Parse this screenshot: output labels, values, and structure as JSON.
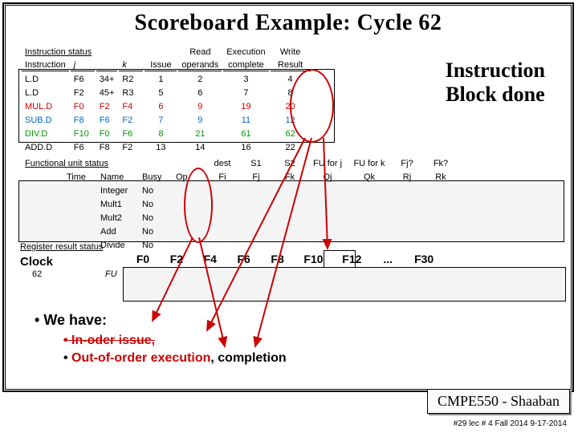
{
  "title": "Scoreboard Example:  Cycle 62",
  "headers": {
    "instr_status": "Instruction status",
    "instruction": "Instruction",
    "j": "j",
    "k": "k",
    "issue": "Issue",
    "read": "Read",
    "operands": "operands",
    "execution": "Execution",
    "complete": "complete",
    "write": "Write",
    "result": "Result"
  },
  "instr": [
    {
      "op": "L.D",
      "j": "F6",
      "k": "34+",
      "r": "R2",
      "issue": "1",
      "read": "2",
      "exec": "3",
      "write": "4"
    },
    {
      "op": "L.D",
      "j": "F2",
      "k": "45+",
      "r": "R3",
      "issue": "5",
      "read": "6",
      "exec": "7",
      "write": "8"
    },
    {
      "op": "MUL.D",
      "j": "F0",
      "k": "F2",
      "r": "F4",
      "issue": "6",
      "read": "9",
      "exec": "19",
      "write": "20"
    },
    {
      "op": "SUB.D",
      "j": "F8",
      "k": "F6",
      "r": "F2",
      "issue": "7",
      "read": "9",
      "exec": "11",
      "write": "12"
    },
    {
      "op": "DIV.D",
      "j": "F10",
      "k": "F0",
      "r": "F6",
      "issue": "8",
      "read": "21",
      "exec": "61",
      "write": "62"
    },
    {
      "op": "ADD.D",
      "j": "F6",
      "k": "F8",
      "r": "F2",
      "issue": "13",
      "read": "14",
      "exec": "16",
      "write": "22"
    }
  ],
  "fu": {
    "label": "Functional unit status",
    "time": "Time",
    "name": "Name",
    "busy": "Busy",
    "op": "Op",
    "dest": "dest",
    "fi": "Fi",
    "s1": "S1",
    "fj": "Fj",
    "s2": "S2",
    "fk": "Fk",
    "fuj": "FU for j",
    "qj": "Qj",
    "fuk": "FU for k",
    "qk": "Qk",
    "fjq": "Fj?",
    "rj": "Rj",
    "fkq": "Fk?",
    "rk": "Rk",
    "units": [
      "Integer",
      "Mult1",
      "Mult2",
      "Add",
      "Divide"
    ],
    "busy_vals": [
      "No",
      "No",
      "No",
      "No",
      "No"
    ]
  },
  "reg": {
    "label": "Register result status",
    "clock": "Clock",
    "clock_val": "62",
    "fu_label": "FU",
    "cols": [
      "F0",
      "F2",
      "F4",
      "F6",
      "F8",
      "F10",
      "F12",
      "...",
      "F30"
    ]
  },
  "big_text_l1": "Instruction",
  "big_text_l2": "Block done",
  "bullets": {
    "b1": "We have:",
    "b2": "In-oder issue,",
    "b3a": "Out-of-order execution",
    "b3b": ", completion"
  },
  "footer": {
    "box": "CMPE550 - Shaaban",
    "line": "#29  lec # 4 Fall 2014  9-17-2014"
  }
}
